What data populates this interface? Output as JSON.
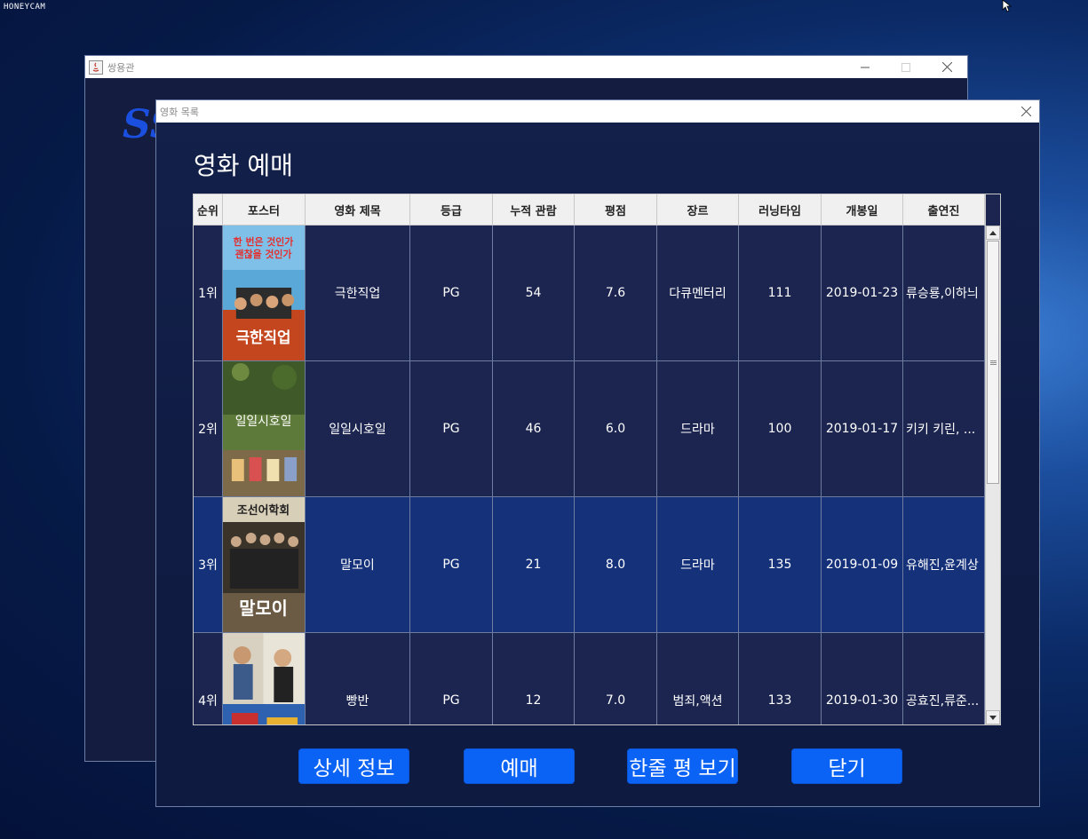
{
  "watermark": "HONEYCAM",
  "back_window": {
    "title": "쌍용관",
    "logo_text": "SS"
  },
  "front_window": {
    "title": "영화 목록",
    "heading": "영화 예매"
  },
  "table": {
    "columns": [
      "순위",
      "포스터",
      "영화 제목",
      "등급",
      "누적 관람",
      "평점",
      "장르",
      "러닝타임",
      "개봉일",
      "출연진"
    ],
    "rows": [
      {
        "rank": "1위",
        "title": "극한직업",
        "grade": "PG",
        "audience": "54",
        "rating": "7.6",
        "genre": "다큐멘터리",
        "runtime": "111",
        "release": "2019-01-23",
        "cast": "류승룡,이하늬"
      },
      {
        "rank": "2위",
        "title": "일일시호일",
        "grade": "PG",
        "audience": "46",
        "rating": "6.0",
        "genre": "드라마",
        "runtime": "100",
        "release": "2019-01-17",
        "cast": "키키 키린, ..."
      },
      {
        "rank": "3위",
        "title": "말모이",
        "grade": "PG",
        "audience": "21",
        "rating": "8.0",
        "genre": "드라마",
        "runtime": "135",
        "release": "2019-01-09",
        "cast": "유해진,윤계상"
      },
      {
        "rank": "4위",
        "title": "빵반",
        "grade": "PG",
        "audience": "12",
        "rating": "7.0",
        "genre": "범죄,액션",
        "runtime": "133",
        "release": "2019-01-30",
        "cast": "공효진,류준..."
      }
    ],
    "selected_row": 2
  },
  "posters": {
    "p1_line1": "한 번은 것인가",
    "p1_line2": "괜찮을 것인가",
    "p1_title": "극한직업",
    "p2_title": "일일시호일",
    "p3_top": "조선어학회",
    "p3_title": "말모이"
  },
  "buttons": {
    "detail": "상세 정보",
    "reserve": "예매",
    "review": "한줄 평 보기",
    "close": "닫기"
  },
  "colors": {
    "accent_button": "#0a63f5",
    "selected_row": "#14317a"
  }
}
